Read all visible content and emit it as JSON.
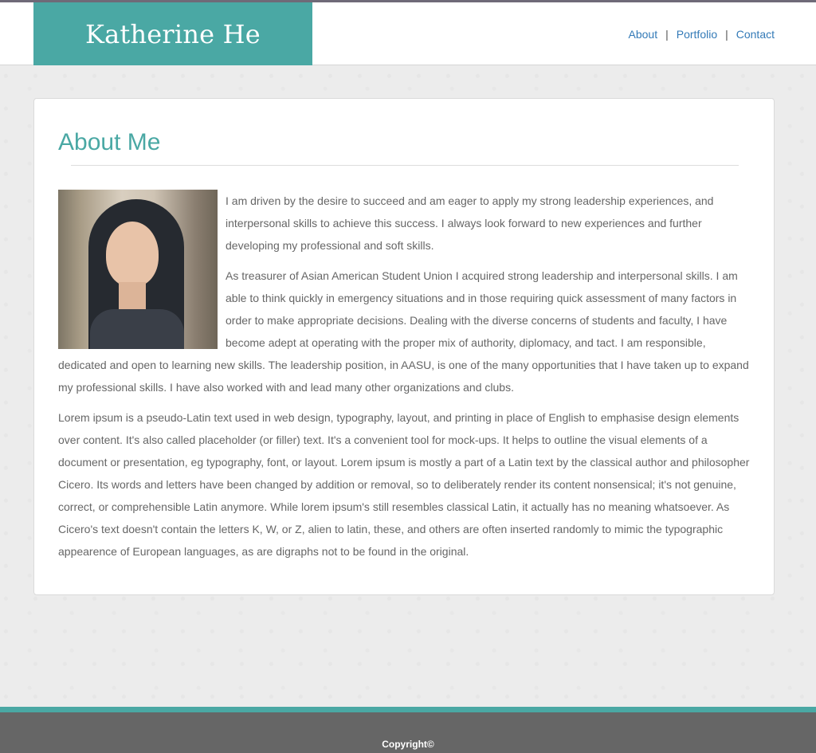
{
  "header": {
    "brand": "Katherine He",
    "nav": [
      {
        "label": "About"
      },
      {
        "label": "Portfolio"
      },
      {
        "label": "Contact"
      }
    ],
    "separator": "|"
  },
  "main": {
    "title": "About Me",
    "photo_alt": "Photo of Katherine He",
    "paragraphs": [
      "I am driven by the desire to succeed and am eager to apply my strong leadership experiences, and interpersonal skills to achieve this success. I always look forward to new experiences and further developing my professional and soft skills.",
      "As treasurer of Asian American Student Union I acquired strong leadership and interpersonal skills. I am able to think quickly in emergency situations and in those requiring quick assessment of many factors in order to make appropriate decisions. Dealing with the diverse concerns of students and faculty, I have become adept at operating with the proper mix of authority, diplomacy, and tact. I am responsible, dedicated and open to learning new skills. The leadership position, in AASU, is one of the many opportunities that I have taken up to expand my professional skills. I have also worked with and lead many other organizations and clubs.",
      "Lorem ipsum is a pseudo-Latin text used in web design, typography, layout, and printing in place of English to emphasise design elements over content. It's also called placeholder (or filler) text. It's a convenient tool for mock-ups. It helps to outline the visual elements of a document or presentation, eg typography, font, or layout. Lorem ipsum is mostly a part of a Latin text by the classical author and philosopher Cicero. Its words and letters have been changed by addition or removal, so to deliberately render its content nonsensical; it's not genuine, correct, or comprehensible Latin anymore. While lorem ipsum's still resembles classical Latin, it actually has no meaning whatsoever. As Cicero's text doesn't contain the letters K, W, or Z, alien to latin, these, and others are often inserted randomly to mimic the typographic appearence of European languages, as are digraphs not to be found in the original."
    ]
  },
  "footer": {
    "copyright": "Copyright©"
  },
  "colors": {
    "accent": "#4aa8a4",
    "link": "#337ab7",
    "footer_bg": "#666666",
    "page_bg": "#ececec",
    "body_text": "#666666"
  }
}
